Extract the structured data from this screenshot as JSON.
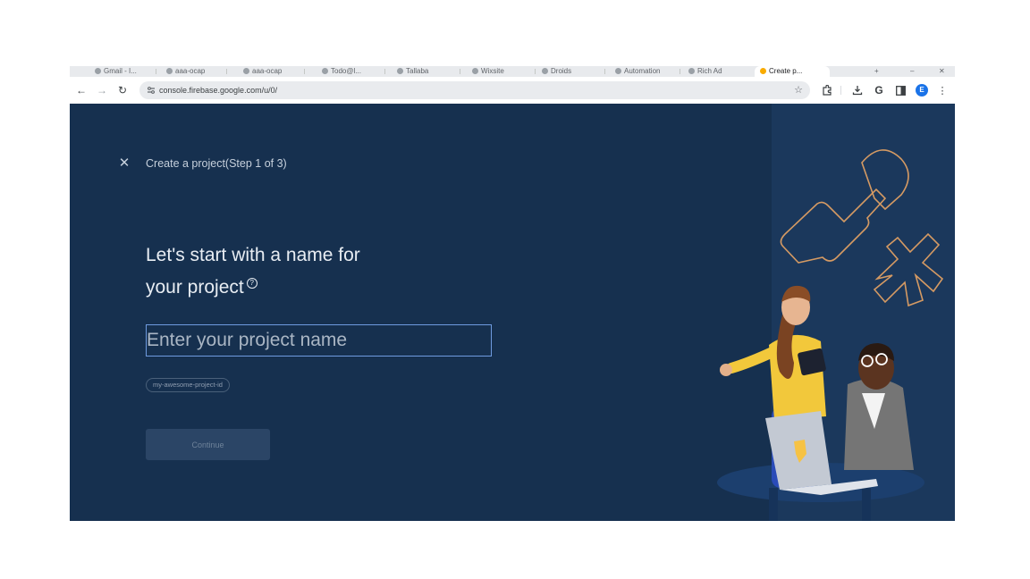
{
  "browser": {
    "tabs": [
      {
        "label": "Gmail - I..."
      },
      {
        "label": "aaa-ocap"
      },
      {
        "label": "aaa-ocap"
      },
      {
        "label": "Todo@l..."
      },
      {
        "label": "Tallaba"
      },
      {
        "label": "Wixsite"
      },
      {
        "label": "Droids"
      },
      {
        "label": "Automation"
      },
      {
        "label": "Rich Ad"
      },
      {
        "label": "Create p..."
      }
    ],
    "url": "console.firebase.google.com/u/0/",
    "profile_initial": "E"
  },
  "page": {
    "step_title": "Create a project(Step 1 of 3)",
    "headline_line1": "Let's start with a name for",
    "headline_line2": "your project",
    "help_icon_glyph": "?",
    "input_placeholder": "Enter your project name",
    "project_id_chip": "my-awesome-project-id",
    "continue_label": "Continue"
  },
  "colors": {
    "page_bg": "#16304f",
    "right_panel_bg": "#1b385c",
    "input_border": "#6f9be0",
    "decor_stroke": "#d59a63"
  },
  "icons": [
    "back-icon",
    "forward-icon",
    "reload-icon",
    "site-info-icon",
    "bookmark-star-icon",
    "extensions-icon",
    "download-icon",
    "google-icon",
    "side-panel-icon",
    "kebab-menu-icon",
    "close-icon",
    "help-icon"
  ]
}
